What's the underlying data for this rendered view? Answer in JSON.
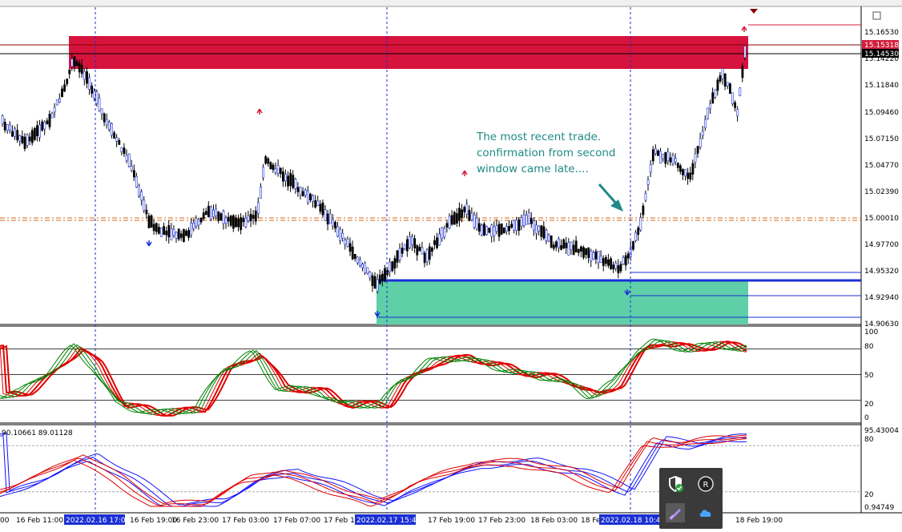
{
  "chart_data": [
    {
      "type": "candlestick",
      "symbol_window": "main",
      "y_ticks": [
        "15.16530",
        "15.14220",
        "15.11840",
        "15.09460",
        "15.07150",
        "15.04770",
        "15.02390",
        "15.00010",
        "14.97700",
        "14.95320",
        "14.92940",
        "14.90630"
      ],
      "price_labels": [
        {
          "text": "15.15318",
          "color": "#d21f3c"
        },
        {
          "text": "15.14530",
          "color": "#000000"
        }
      ],
      "zones": [
        {
          "name": "supply",
          "color": "#d6133c",
          "price_range": [
            15.141,
            15.158
          ]
        },
        {
          "name": "demand",
          "color": "#5fcfa8",
          "price_range": [
            14.906,
            14.938
          ]
        }
      ],
      "levels": [
        {
          "price": 15.0005,
          "style": "dash-dot",
          "color": "#d2691e"
        },
        {
          "price": 14.939,
          "style": "thick",
          "color": "#1a2fd6"
        }
      ],
      "separators": [
        "2022.02.16 17:00",
        "2022.02.17 15:45",
        "2022.02.18 10:45"
      ],
      "annotation": [
        "The most recent trade.",
        "confirmation from second",
        "window came late...."
      ]
    },
    {
      "type": "line",
      "panel": "stochastic",
      "y_ticks": [
        "100",
        "80",
        "50",
        "20",
        "0"
      ],
      "levels": [
        80,
        50,
        20
      ],
      "series_colors": [
        "#e00000",
        "#e00000",
        "#e00000",
        "#008000",
        "#008000",
        "#008000"
      ]
    },
    {
      "type": "line",
      "panel": "oscillator",
      "header": "90.10661 89.01128",
      "y_ticks": [
        "95.43004",
        "80",
        "20",
        "0.94749"
      ],
      "levels": [
        80,
        20
      ],
      "series_colors": [
        "#1010ff",
        "#1010ff",
        "#1010ff",
        "#e00000",
        "#e00000",
        "#e00000"
      ]
    }
  ],
  "time_axis": {
    "labels": [
      "00",
      "16 Feb 11:00",
      "16 Feb 19:00",
      "16 Feb 23:00",
      "17 Feb 03:00",
      "17 Feb 07:00",
      "17 Feb 1",
      "17 Feb 19:00",
      "17 Feb 23:00",
      "18 Feb 03:00",
      "18 Fe",
      "18 Feb 19:00"
    ],
    "highlighted": [
      "2022.02.16 17:00",
      "2022.02.17 15:45",
      "2022.02.18 10:45"
    ]
  },
  "tray": {
    "icons": [
      "windows-security-icon",
      "app-icon-r",
      "pen-icon",
      "cloud-icon"
    ]
  }
}
